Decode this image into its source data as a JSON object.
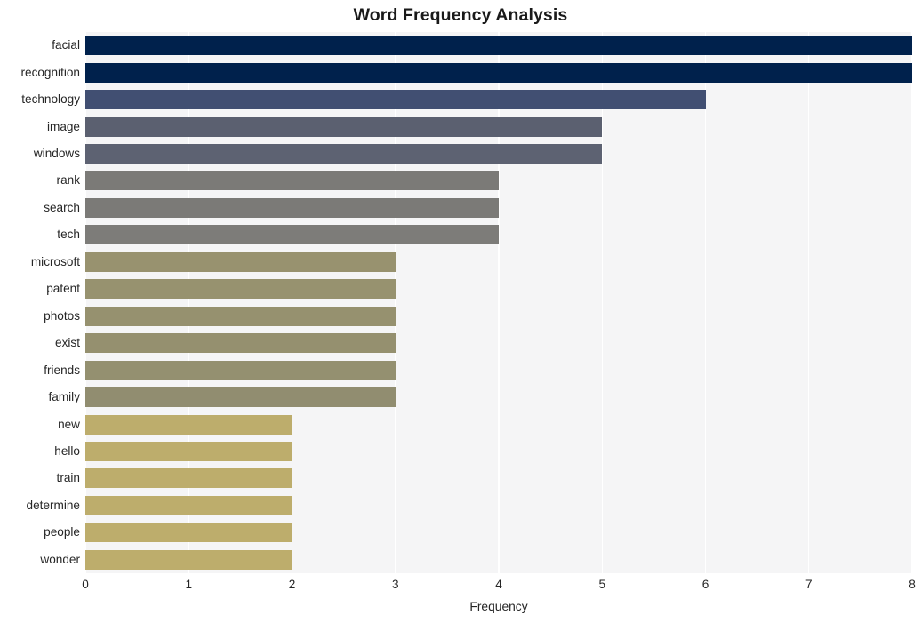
{
  "chart_data": {
    "type": "bar",
    "orientation": "horizontal",
    "title": "Word Frequency Analysis",
    "xlabel": "Frequency",
    "ylabel": "",
    "xlim": [
      0,
      8
    ],
    "xticks": [
      "0",
      "1",
      "2",
      "3",
      "4",
      "5",
      "6",
      "7",
      "8"
    ],
    "grid": true,
    "legend": null,
    "categories": [
      "facial",
      "recognition",
      "technology",
      "image",
      "windows",
      "rank",
      "search",
      "tech",
      "microsoft",
      "patent",
      "photos",
      "exist",
      "friends",
      "family",
      "new",
      "hello",
      "train",
      "determine",
      "people",
      "wonder"
    ],
    "values": [
      8,
      8,
      6,
      5,
      5,
      4,
      4,
      4,
      3,
      3,
      3,
      3,
      3,
      3,
      2,
      2,
      2,
      2,
      2,
      2
    ],
    "bar_colors": [
      "#00214c",
      "#00214c",
      "#414f72",
      "#5b6070",
      "#5d6272",
      "#7b7a77",
      "#7b7a77",
      "#7d7c79",
      "#98926f",
      "#97926f",
      "#96916f",
      "#95906f",
      "#949070",
      "#918d70",
      "#bdad6c",
      "#bdad6c",
      "#bdad6c",
      "#bdad6c",
      "#bdad6c",
      "#bdad6c"
    ]
  },
  "style": {
    "plot_background": "#f5f5f6",
    "gridline_color": "#ffffff",
    "figure_background": "#ffffff",
    "text_color": "#262626",
    "title_color": "#1a1a1a"
  }
}
